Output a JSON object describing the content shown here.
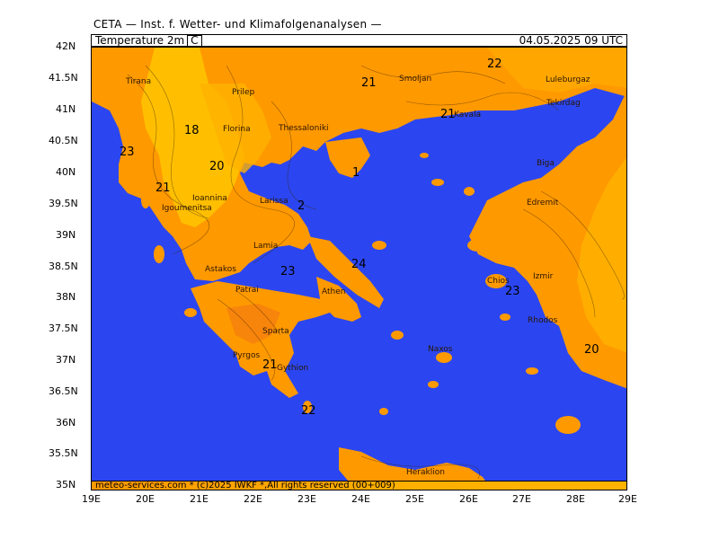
{
  "header": {
    "title": "CETA — Inst. f. Wetter- und Klimafolgenanalysen —"
  },
  "title_bar": {
    "parameter": "Temperature 2m",
    "unit": "C",
    "valid_time": "04.05.2025 09 UTC"
  },
  "footer": {
    "text": "meteo-services.com * (c)2025 IWKF *,All rights reserved (00+009)"
  },
  "axes": {
    "lat_labels": [
      "42N",
      "41.5N",
      "41N",
      "40.5N",
      "40N",
      "39.5N",
      "39N",
      "38.5N",
      "38N",
      "37.5N",
      "37N",
      "36.5N",
      "36N",
      "35.5N",
      "35N"
    ],
    "lon_labels": [
      "19E",
      "20E",
      "21E",
      "22E",
      "23E",
      "24E",
      "25E",
      "26E",
      "27E",
      "28E",
      "29E"
    ]
  },
  "cities": [
    "Tirana",
    "Prilep",
    "Smoljan",
    "Luleburgaz",
    "Tekirdag",
    "Florina",
    "Thessaloniki",
    "Kavala",
    "Biga",
    "Edremit",
    "Ioannina",
    "Igoumenitsa",
    "Larissa",
    "Lamia",
    "Astakos",
    "Patrai",
    "Athen",
    "Izmir",
    "Pyrgos",
    "Sparta",
    "Gythion",
    "Heraklion",
    "Chios",
    "Naxos",
    "Rhodos"
  ],
  "contour_labels": [
    "22",
    "21",
    "21",
    "18",
    "23",
    "20",
    "21",
    "2",
    "24",
    "23",
    "21",
    "20",
    "22",
    "23",
    "1"
  ],
  "colors": {
    "sea": "#2b46f0",
    "land_warm": "#ff9900",
    "land_mild": "#ffb300",
    "land_cool": "#ffc600",
    "land_hot": "#f47a10"
  }
}
